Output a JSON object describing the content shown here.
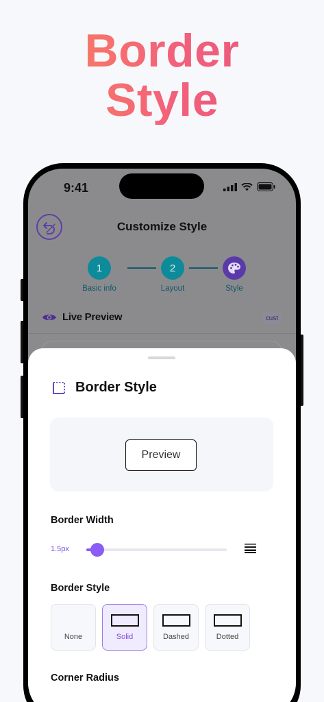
{
  "hero": {
    "line1": "Border",
    "line2": "Style"
  },
  "status_bar": {
    "time": "9:41"
  },
  "nav": {
    "title": "Customize Style"
  },
  "stepper": {
    "steps": [
      {
        "number": "1",
        "label": "Basic info",
        "color": "#0e8b9a"
      },
      {
        "number": "2",
        "label": "Layout",
        "color": "#0e8b9a"
      },
      {
        "number": "",
        "label": "Style",
        "color": "#5a3aa8",
        "icon": "palette-icon"
      }
    ]
  },
  "live_preview": {
    "label": "Live Preview",
    "chip": "cust"
  },
  "sheet": {
    "title": "Border Style",
    "preview_button": "Preview",
    "border_width": {
      "label": "Border Width",
      "value_text": "1.5px",
      "slider_fraction": 0.08
    },
    "border_style": {
      "label": "Border Style",
      "options": [
        {
          "name": "None",
          "selected": false
        },
        {
          "name": "Solid",
          "selected": true
        },
        {
          "name": "Dashed",
          "selected": false
        },
        {
          "name": "Dotted",
          "selected": false
        }
      ]
    },
    "corner_radius": {
      "label": "Corner Radius"
    }
  },
  "colors": {
    "accent": "#8b5cf6",
    "teal": "#0e8b9a",
    "hero_start": "#fb8a5a",
    "hero_end": "#e4547f"
  }
}
